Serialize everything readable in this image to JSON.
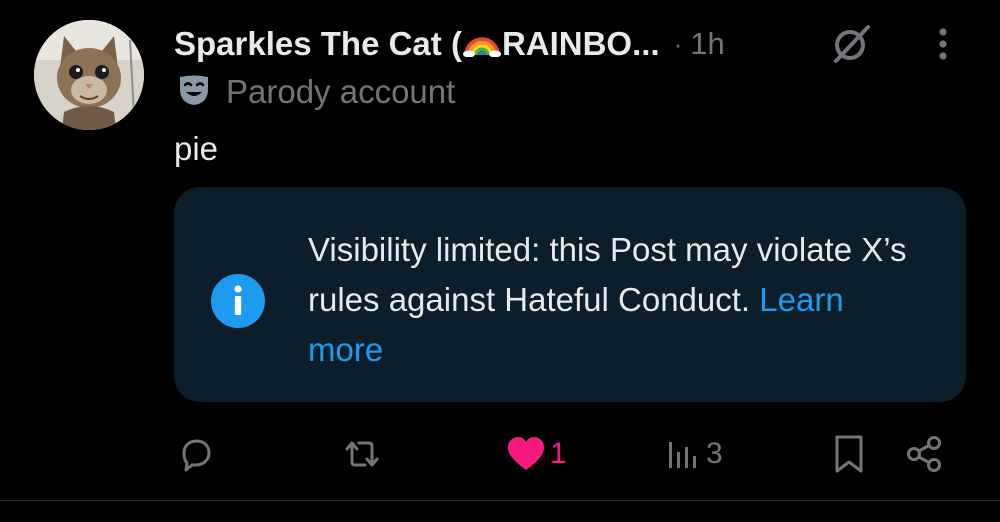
{
  "post": {
    "display_name": "Sparkles The Cat (",
    "display_name_suffix": "RAINBO...",
    "timestamp": "1h",
    "label": "Parody account",
    "text": "pie"
  },
  "notice": {
    "text": "Visibility limited: this Post may violate X’s rules against Hateful Conduct.",
    "link": "Learn more"
  },
  "actions": {
    "likes": "1",
    "views": "3"
  },
  "icons": [
    "grok-icon",
    "more-icon",
    "parody-mask-icon",
    "info-icon",
    "reply-icon",
    "repost-icon",
    "like-icon",
    "views-icon",
    "bookmark-icon",
    "share-icon"
  ],
  "colors": {
    "background": "#000000",
    "text": "#e7e9ea",
    "secondary": "#71767b",
    "accent": "#1d9bf0",
    "like": "#f91880",
    "notice_bg": "#0b1e29"
  }
}
